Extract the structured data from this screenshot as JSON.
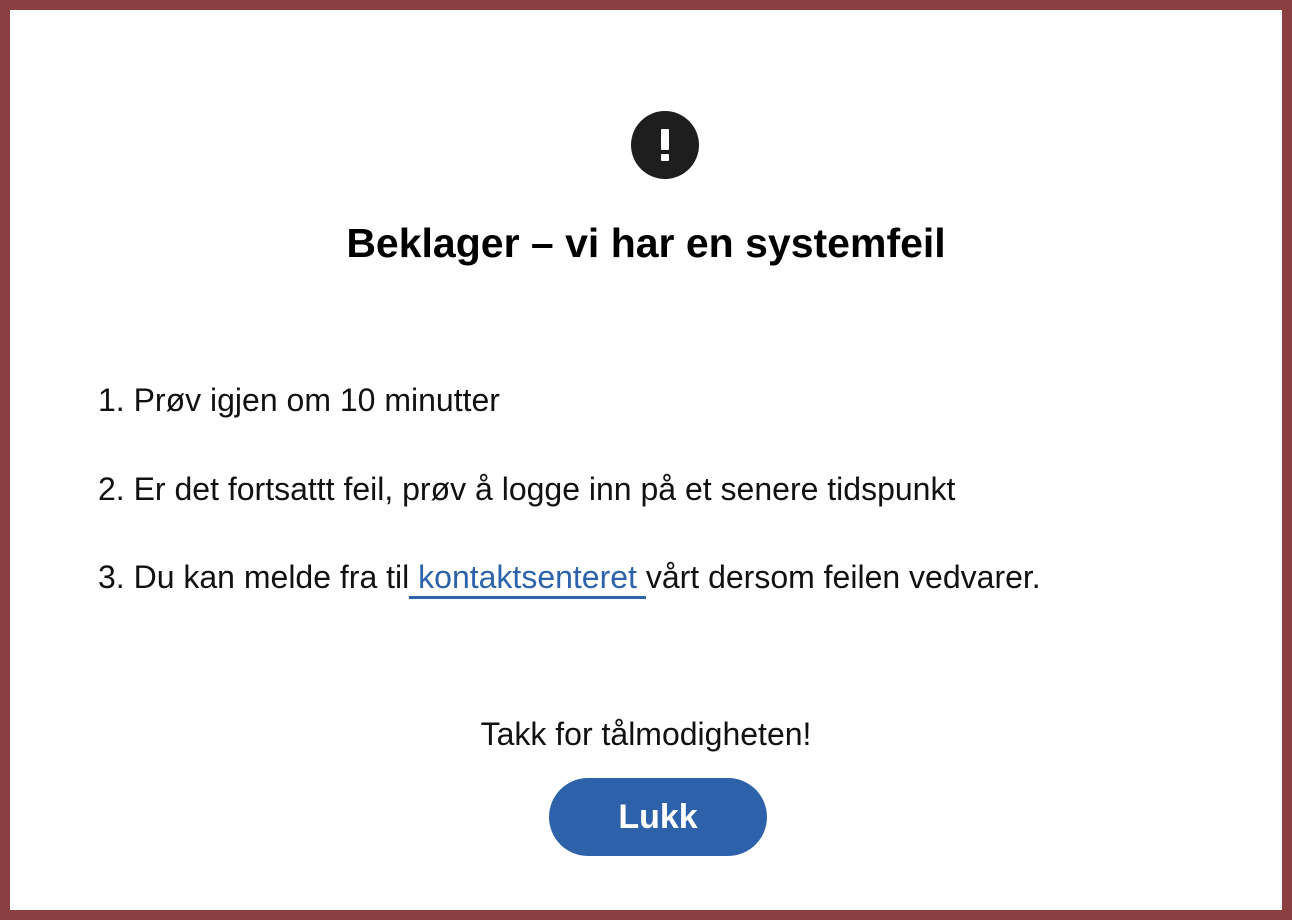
{
  "colors": {
    "frame_border": "#8c3f42",
    "accent_blue": "#2d62aa",
    "icon_dark": "#1e1e1e"
  },
  "icon": "exclamation-circle-icon",
  "title": "Beklager – vi har en systemfeil",
  "steps": [
    {
      "text": "1. Prøv igjen om 10 minutter"
    },
    {
      "text": "2. Er det fortsattt feil, prøv å logge inn på et senere tidspunkt"
    },
    {
      "prefix": "3. Du kan melde fra til",
      "link_text": " kontaktsenteret ",
      "suffix": "vårt dersom feilen vedvarer."
    }
  ],
  "thanks": "Takk for tålmodigheten!",
  "close_button_label": "Lukk"
}
